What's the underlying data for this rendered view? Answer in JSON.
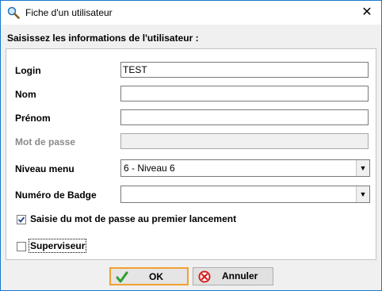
{
  "window": {
    "title": "Fiche d'un utilisateur",
    "close_glyph": "✕",
    "title_icon": "magnifier-icon"
  },
  "form": {
    "heading": "Saisissez les informations de l'utilisateur :",
    "login": {
      "label": "Login",
      "value": "TEST"
    },
    "nom": {
      "label": "Nom",
      "value": ""
    },
    "prenom": {
      "label": "Prénom",
      "value": ""
    },
    "mot_de_passe": {
      "label": "Mot de passe",
      "value": "",
      "disabled": true
    },
    "niveau_menu": {
      "label": "Niveau menu",
      "value": "6 - Niveau 6"
    },
    "numero_badge": {
      "label": "Numéro de Badge",
      "value": ""
    },
    "saisie_mdp": {
      "label": "Saisie du mot de passe au premier lancement",
      "checked": true
    },
    "superviseur": {
      "label": "Superviseur",
      "checked": false
    }
  },
  "buttons": {
    "ok": {
      "label": "OK",
      "icon": "checkmark-icon"
    },
    "annuler": {
      "label": "Annuler",
      "icon": "cancel-icon"
    }
  },
  "colors": {
    "window_border": "#1a78d0",
    "default_button_border": "#f0a030",
    "check_green": "#2e9e2e",
    "cancel_red": "#d42020"
  }
}
